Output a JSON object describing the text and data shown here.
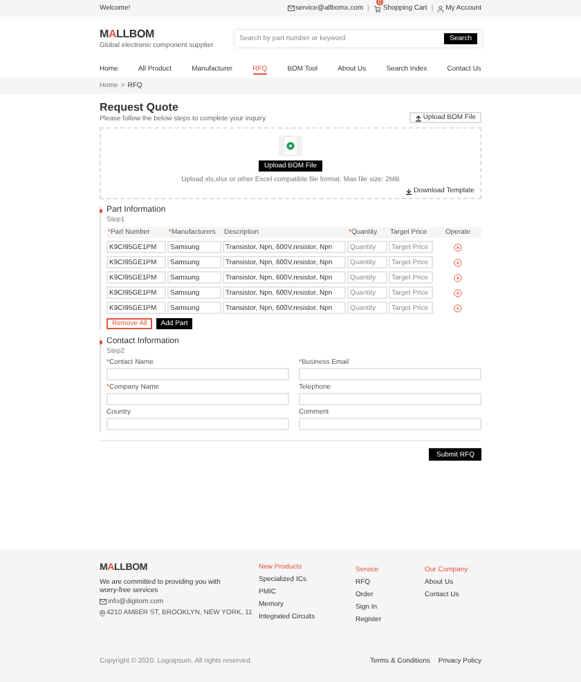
{
  "top_bar": {
    "welcome": "Welcome!",
    "email": "service@allbomx.com",
    "cart": "Shopping Cart",
    "cart_count": "0",
    "account": "My Account",
    "separators": [
      "|",
      "|"
    ]
  },
  "header": {
    "logo_parts": [
      "M",
      "A",
      "LLBOM"
    ],
    "tagline": "Global electronic component supplier",
    "search_placeholder": "Search by part number or keyword",
    "search_button": "Search"
  },
  "nav": [
    {
      "label": "Home",
      "selected": false
    },
    {
      "label": "All Product",
      "selected": false
    },
    {
      "label": "Manufacturer",
      "selected": false
    },
    {
      "label": "RFQ",
      "selected": true
    },
    {
      "label": "BOM Tool",
      "selected": false
    },
    {
      "label": "About Us",
      "selected": false
    },
    {
      "label": "Search Index",
      "selected": false
    },
    {
      "label": "Contact Us",
      "selected": false
    }
  ],
  "breadcrumb": [
    "Home",
    ">",
    "RFQ"
  ],
  "title": "Request Quote",
  "subtitle": "Please follow the below steps to complete your inquiry",
  "upload_top": "Upload BOM File",
  "upload_area": {
    "button": "Upload BOM File",
    "hint": "Upload xls,xlsx or other Excel compatible file format. Max file size:  2MB",
    "template": "Download Template"
  },
  "part_section": {
    "title": "Part Information",
    "step": "Step1",
    "columns": [
      {
        "label": "Part Number",
        "mark": "*"
      },
      {
        "label": "Manufacturers",
        "mark": "*"
      },
      {
        "label": "Description"
      },
      {
        "label": "Quantity",
        "mark": "*"
      },
      {
        "label": "Target Price"
      },
      {
        "label": "Operate"
      }
    ],
    "rows": [
      {
        "part": "K9CI95GE1PM",
        "manufacturer": "Samsung",
        "description": "Transistor, Npn, 600V,resistor, Npn",
        "quantity_placeholder": "Quantity",
        "price_placeholder": "Target Price"
      },
      {
        "part": "K9CI95GE1PM",
        "manufacturer": "Samsung",
        "description": "Transistor, Npn, 600V,resistor, Npn",
        "quantity_placeholder": "Quantity",
        "price_placeholder": "Target Price"
      },
      {
        "part": "K9CI95GE1PM",
        "manufacturer": "Samsung",
        "description": "Transistor, Npn, 600V,resistor, Npn",
        "quantity_placeholder": "Quantity",
        "price_placeholder": "Target Price"
      },
      {
        "part": "K9CI95GE1PM",
        "manufacturer": "Samsung",
        "description": "Transistor, Npn, 600V,resistor, Npn",
        "quantity_placeholder": "Quantity",
        "price_placeholder": "Target Price"
      },
      {
        "part": "K9CI95GE1PM",
        "manufacturer": "Samsung",
        "description": "Transistor, Npn, 600V,resistor, Npn",
        "quantity_placeholder": "Quantity",
        "price_placeholder": "Target Price"
      }
    ],
    "remove_all": "Remove All",
    "add_part": "Add Part"
  },
  "contact_section": {
    "title": "Contact Information",
    "step": "Step2",
    "fields": [
      {
        "label": "Contact Name",
        "mark": "*"
      },
      {
        "label": "Business Email",
        "mark": "*"
      },
      {
        "label": "Company Name",
        "mark": "*"
      },
      {
        "label": "Telephone"
      },
      {
        "label": "Country"
      },
      {
        "label": "Comment"
      }
    ]
  },
  "submit": "Submit RFQ",
  "footer": {
    "logo_parts": [
      "M",
      "A",
      "LLBOM"
    ],
    "tagline": "We are committed to providing you with worry-free services",
    "email": "info@digitom.com",
    "address": "4210 AMBER ST, BROOKLYN, NEW YORK, 11",
    "columns": [
      {
        "title": "New Products",
        "links": [
          "Specialized ICs",
          "PMIC",
          "Memory",
          "Integrated Circuits"
        ]
      },
      {
        "title": "Service",
        "links": [
          "RFQ",
          "Order",
          "Sign In",
          "Register"
        ]
      },
      {
        "title": "Our Company",
        "links": [
          "About Us",
          "Contact Us"
        ]
      }
    ],
    "copyright": "Copyright © 2020. Logoipsum. All rights reserved.",
    "bottom_links": [
      "Terms & Conditions",
      "Privacy Policy"
    ]
  }
}
